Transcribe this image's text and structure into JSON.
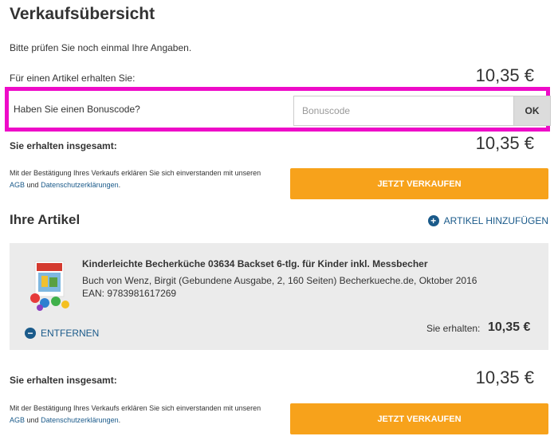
{
  "page": {
    "title": "Verkaufsübersicht",
    "intro": "Bitte prüfen Sie noch einmal Ihre Angaben."
  },
  "summary": {
    "per_item_label": "Für einen Artikel erhalten Sie:",
    "per_item_price": "10,35 €",
    "bonus_label": "Haben Sie einen Bonuscode?",
    "bonus_placeholder": "Bonuscode",
    "ok_label": "OK",
    "total_label": "Sie erhalten insgesamt:",
    "total_price": "10,35 €",
    "legal_prefix": "Mit der Bestätigung Ihres Verkaufs erklären Sie sich einverstanden mit unseren",
    "legal_agb": "AGB",
    "legal_and": "und",
    "legal_privacy": "Datenschutzerklärungen",
    "legal_suffix": ".",
    "sell_label": "JETZT VERKAUFEN"
  },
  "items_section": {
    "title": "Ihre Artikel",
    "add_label": "ARTIKEL HINZUFÜGEN",
    "items": [
      {
        "title": "Kinderleichte Becherküche 03634 Backset 6-tlg. für Kinder inkl. Messbecher",
        "meta": "Buch von Wenz, Birgit (Gebundene Ausgabe, 2, 160 Seiten) Becherkueche.de, Oktober 2016",
        "ean": "EAN: 9783981617269",
        "remove_label": "ENTFERNEN",
        "price_label": "Sie erhalten:",
        "price": "10,35 €"
      }
    ]
  },
  "footer_summary": {
    "total_label": "Sie erhalten insgesamt:",
    "total_price": "10,35 €",
    "legal_prefix": "Mit der Bestätigung Ihres Verkaufs erklären Sie sich einverstanden mit unseren",
    "legal_agb": "AGB",
    "legal_and": "und",
    "legal_privacy": "Datenschutzerklärungen",
    "legal_suffix": ".",
    "sell_label": "JETZT VERKAUFEN"
  },
  "colors": {
    "accent": "#f7a21b",
    "link": "#1a5a8a",
    "highlight": "#ee0bc8"
  }
}
